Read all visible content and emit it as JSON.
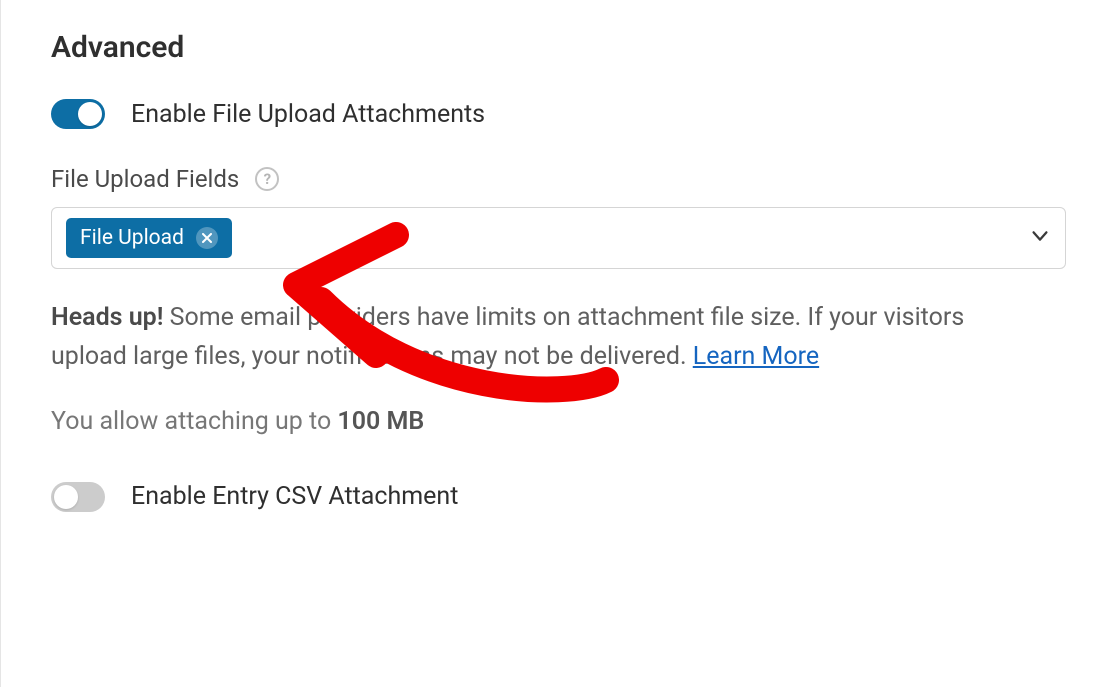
{
  "section": {
    "heading": "Advanced"
  },
  "toggles": {
    "file_upload_attachments": {
      "label": "Enable File Upload Attachments",
      "value": true
    },
    "entry_csv_attachment": {
      "label": "Enable Entry CSV Attachment",
      "value": false
    }
  },
  "file_upload_fields": {
    "label": "File Upload Fields",
    "selected": [
      {
        "label": "File Upload"
      }
    ]
  },
  "heads_up": {
    "prefix": "Heads up!",
    "text": " Some email providers have limits on attachment file size. If your visitors upload large files, your notifications may not be delivered. ",
    "learn_more": "Learn More"
  },
  "attach_limit": {
    "text_prefix": "You allow attaching up to ",
    "limit": "100 MB"
  }
}
